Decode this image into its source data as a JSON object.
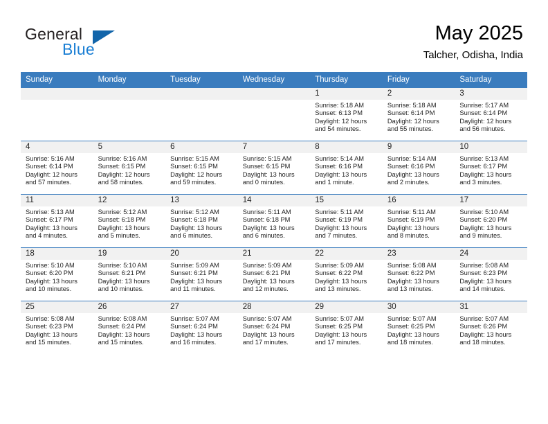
{
  "brand": {
    "word_one": "General",
    "word_two": "Blue",
    "flag_icon": "triangle-flag-icon"
  },
  "header": {
    "title": "May 2025",
    "subtitle": "Talcher, Odisha, India"
  },
  "colors": {
    "header_blue": "#3a7cbe",
    "brand_blue": "#1b7fd4",
    "flag_blue": "#1265aa",
    "date_band": "#f1f1f1"
  },
  "weekday_headers": [
    "Sunday",
    "Monday",
    "Tuesday",
    "Wednesday",
    "Thursday",
    "Friday",
    "Saturday"
  ],
  "weeks": [
    [
      {
        "day": "",
        "sunrise": "",
        "sunset": "",
        "daylight_line1": "",
        "daylight_line2": ""
      },
      {
        "day": "",
        "sunrise": "",
        "sunset": "",
        "daylight_line1": "",
        "daylight_line2": ""
      },
      {
        "day": "",
        "sunrise": "",
        "sunset": "",
        "daylight_line1": "",
        "daylight_line2": ""
      },
      {
        "day": "",
        "sunrise": "",
        "sunset": "",
        "daylight_line1": "",
        "daylight_line2": ""
      },
      {
        "day": "1",
        "sunrise": "Sunrise: 5:18 AM",
        "sunset": "Sunset: 6:13 PM",
        "daylight_line1": "Daylight: 12 hours",
        "daylight_line2": "and 54 minutes."
      },
      {
        "day": "2",
        "sunrise": "Sunrise: 5:18 AM",
        "sunset": "Sunset: 6:14 PM",
        "daylight_line1": "Daylight: 12 hours",
        "daylight_line2": "and 55 minutes."
      },
      {
        "day": "3",
        "sunrise": "Sunrise: 5:17 AM",
        "sunset": "Sunset: 6:14 PM",
        "daylight_line1": "Daylight: 12 hours",
        "daylight_line2": "and 56 minutes."
      }
    ],
    [
      {
        "day": "4",
        "sunrise": "Sunrise: 5:16 AM",
        "sunset": "Sunset: 6:14 PM",
        "daylight_line1": "Daylight: 12 hours",
        "daylight_line2": "and 57 minutes."
      },
      {
        "day": "5",
        "sunrise": "Sunrise: 5:16 AM",
        "sunset": "Sunset: 6:15 PM",
        "daylight_line1": "Daylight: 12 hours",
        "daylight_line2": "and 58 minutes."
      },
      {
        "day": "6",
        "sunrise": "Sunrise: 5:15 AM",
        "sunset": "Sunset: 6:15 PM",
        "daylight_line1": "Daylight: 12 hours",
        "daylight_line2": "and 59 minutes."
      },
      {
        "day": "7",
        "sunrise": "Sunrise: 5:15 AM",
        "sunset": "Sunset: 6:15 PM",
        "daylight_line1": "Daylight: 13 hours",
        "daylight_line2": "and 0 minutes."
      },
      {
        "day": "8",
        "sunrise": "Sunrise: 5:14 AM",
        "sunset": "Sunset: 6:16 PM",
        "daylight_line1": "Daylight: 13 hours",
        "daylight_line2": "and 1 minute."
      },
      {
        "day": "9",
        "sunrise": "Sunrise: 5:14 AM",
        "sunset": "Sunset: 6:16 PM",
        "daylight_line1": "Daylight: 13 hours",
        "daylight_line2": "and 2 minutes."
      },
      {
        "day": "10",
        "sunrise": "Sunrise: 5:13 AM",
        "sunset": "Sunset: 6:17 PM",
        "daylight_line1": "Daylight: 13 hours",
        "daylight_line2": "and 3 minutes."
      }
    ],
    [
      {
        "day": "11",
        "sunrise": "Sunrise: 5:13 AM",
        "sunset": "Sunset: 6:17 PM",
        "daylight_line1": "Daylight: 13 hours",
        "daylight_line2": "and 4 minutes."
      },
      {
        "day": "12",
        "sunrise": "Sunrise: 5:12 AM",
        "sunset": "Sunset: 6:18 PM",
        "daylight_line1": "Daylight: 13 hours",
        "daylight_line2": "and 5 minutes."
      },
      {
        "day": "13",
        "sunrise": "Sunrise: 5:12 AM",
        "sunset": "Sunset: 6:18 PM",
        "daylight_line1": "Daylight: 13 hours",
        "daylight_line2": "and 6 minutes."
      },
      {
        "day": "14",
        "sunrise": "Sunrise: 5:11 AM",
        "sunset": "Sunset: 6:18 PM",
        "daylight_line1": "Daylight: 13 hours",
        "daylight_line2": "and 6 minutes."
      },
      {
        "day": "15",
        "sunrise": "Sunrise: 5:11 AM",
        "sunset": "Sunset: 6:19 PM",
        "daylight_line1": "Daylight: 13 hours",
        "daylight_line2": "and 7 minutes."
      },
      {
        "day": "16",
        "sunrise": "Sunrise: 5:11 AM",
        "sunset": "Sunset: 6:19 PM",
        "daylight_line1": "Daylight: 13 hours",
        "daylight_line2": "and 8 minutes."
      },
      {
        "day": "17",
        "sunrise": "Sunrise: 5:10 AM",
        "sunset": "Sunset: 6:20 PM",
        "daylight_line1": "Daylight: 13 hours",
        "daylight_line2": "and 9 minutes."
      }
    ],
    [
      {
        "day": "18",
        "sunrise": "Sunrise: 5:10 AM",
        "sunset": "Sunset: 6:20 PM",
        "daylight_line1": "Daylight: 13 hours",
        "daylight_line2": "and 10 minutes."
      },
      {
        "day": "19",
        "sunrise": "Sunrise: 5:10 AM",
        "sunset": "Sunset: 6:21 PM",
        "daylight_line1": "Daylight: 13 hours",
        "daylight_line2": "and 10 minutes."
      },
      {
        "day": "20",
        "sunrise": "Sunrise: 5:09 AM",
        "sunset": "Sunset: 6:21 PM",
        "daylight_line1": "Daylight: 13 hours",
        "daylight_line2": "and 11 minutes."
      },
      {
        "day": "21",
        "sunrise": "Sunrise: 5:09 AM",
        "sunset": "Sunset: 6:21 PM",
        "daylight_line1": "Daylight: 13 hours",
        "daylight_line2": "and 12 minutes."
      },
      {
        "day": "22",
        "sunrise": "Sunrise: 5:09 AM",
        "sunset": "Sunset: 6:22 PM",
        "daylight_line1": "Daylight: 13 hours",
        "daylight_line2": "and 13 minutes."
      },
      {
        "day": "23",
        "sunrise": "Sunrise: 5:08 AM",
        "sunset": "Sunset: 6:22 PM",
        "daylight_line1": "Daylight: 13 hours",
        "daylight_line2": "and 13 minutes."
      },
      {
        "day": "24",
        "sunrise": "Sunrise: 5:08 AM",
        "sunset": "Sunset: 6:23 PM",
        "daylight_line1": "Daylight: 13 hours",
        "daylight_line2": "and 14 minutes."
      }
    ],
    [
      {
        "day": "25",
        "sunrise": "Sunrise: 5:08 AM",
        "sunset": "Sunset: 6:23 PM",
        "daylight_line1": "Daylight: 13 hours",
        "daylight_line2": "and 15 minutes."
      },
      {
        "day": "26",
        "sunrise": "Sunrise: 5:08 AM",
        "sunset": "Sunset: 6:24 PM",
        "daylight_line1": "Daylight: 13 hours",
        "daylight_line2": "and 15 minutes."
      },
      {
        "day": "27",
        "sunrise": "Sunrise: 5:07 AM",
        "sunset": "Sunset: 6:24 PM",
        "daylight_line1": "Daylight: 13 hours",
        "daylight_line2": "and 16 minutes."
      },
      {
        "day": "28",
        "sunrise": "Sunrise: 5:07 AM",
        "sunset": "Sunset: 6:24 PM",
        "daylight_line1": "Daylight: 13 hours",
        "daylight_line2": "and 17 minutes."
      },
      {
        "day": "29",
        "sunrise": "Sunrise: 5:07 AM",
        "sunset": "Sunset: 6:25 PM",
        "daylight_line1": "Daylight: 13 hours",
        "daylight_line2": "and 17 minutes."
      },
      {
        "day": "30",
        "sunrise": "Sunrise: 5:07 AM",
        "sunset": "Sunset: 6:25 PM",
        "daylight_line1": "Daylight: 13 hours",
        "daylight_line2": "and 18 minutes."
      },
      {
        "day": "31",
        "sunrise": "Sunrise: 5:07 AM",
        "sunset": "Sunset: 6:26 PM",
        "daylight_line1": "Daylight: 13 hours",
        "daylight_line2": "and 18 minutes."
      }
    ]
  ]
}
